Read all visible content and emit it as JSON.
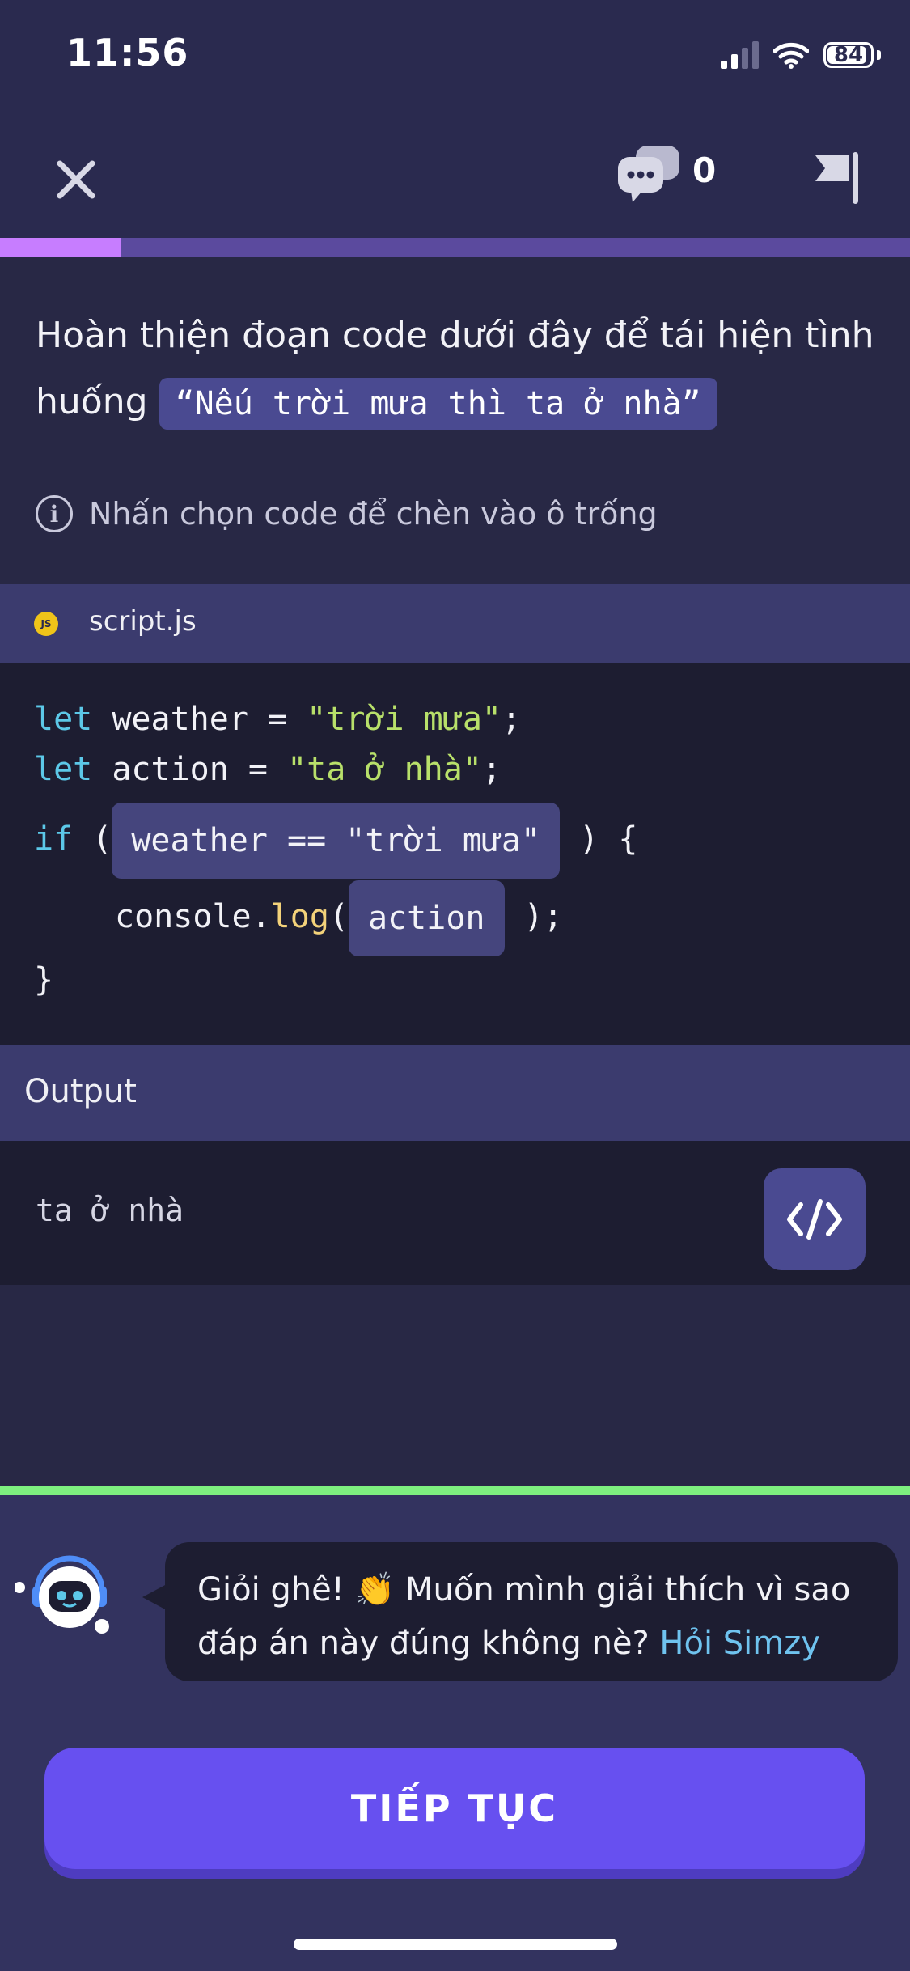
{
  "status_bar": {
    "time": "11:56",
    "battery": "84"
  },
  "header": {
    "comment_count": "0"
  },
  "progress": {
    "fraction": 0.133
  },
  "question": {
    "text": "Hoàn thiện đoạn code dưới đây để tái hiện tình huống",
    "quote": "“Nếu trời mưa thì ta ở nhà”"
  },
  "hint": {
    "text": "Nhấn chọn code để chèn vào ô trống"
  },
  "file": {
    "icon_text": "JS",
    "name": "script.js"
  },
  "code": {
    "line1": {
      "kw": "let",
      "mid": " weather = ",
      "str": "\"trời mưa\"",
      "end": ";"
    },
    "line2": {
      "kw": "let",
      "mid": " action = ",
      "str": "\"ta ở nhà\"",
      "end": ";"
    },
    "line3": {
      "kw": "if",
      "open": " (",
      "blank": "weather == \"trời mưa\"",
      "close": " ) {"
    },
    "line4": {
      "obj": "console.",
      "fn": "log",
      "open": "(",
      "blank": "action",
      "close": " );"
    },
    "line5": "}"
  },
  "output": {
    "label": "Output",
    "text": "ta ở nhà"
  },
  "feedback": {
    "message": "Giỏi ghê! 👏 Muốn mình giải thích vì sao đáp án này đúng không nè?",
    "link": "Hỏi Simzy"
  },
  "continue_button": {
    "label": "TIẾP TỤC"
  },
  "colors": {
    "background": "#2a2a4f",
    "accent": "#6750f0",
    "progress": "#c77dff",
    "success": "#7ef07f",
    "keyword": "#5cc8e8",
    "string": "#b8e06a"
  }
}
